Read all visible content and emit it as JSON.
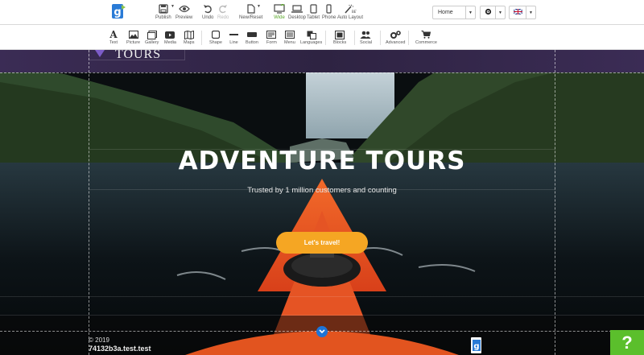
{
  "toolbar": {
    "publish": "Publish",
    "preview": "Preview",
    "undo": "Undo",
    "redo": "Redo",
    "new_reset": "New/Reset",
    "wide": "Wide",
    "desktop": "Desktop",
    "tablet": "Tablet",
    "phone": "Phone",
    "auto_layout": "Auto Layout",
    "page_select": "Home",
    "language_flag": "UK flag",
    "accent_color": "#5aa82a"
  },
  "elements_bar": {
    "items": [
      "Text",
      "Picture",
      "Gallery",
      "Media",
      "Maps",
      "Shape",
      "Line",
      "Button",
      "Form",
      "Menu",
      "Languages",
      "Blocks",
      "Social",
      "Advanced",
      "Commerce"
    ]
  },
  "hero": {
    "logo_text": "TOURS",
    "title": "ADVENTURE TOURS",
    "subtitle": "Trusted by 1 million customers and counting",
    "cta_label": "Let's travel!",
    "cta_color": "#f5a623"
  },
  "footer": {
    "copyright": "© 2019",
    "domain": "74132b3a.test.test"
  },
  "help": {
    "label": "?",
    "color": "#5bbf2c"
  }
}
